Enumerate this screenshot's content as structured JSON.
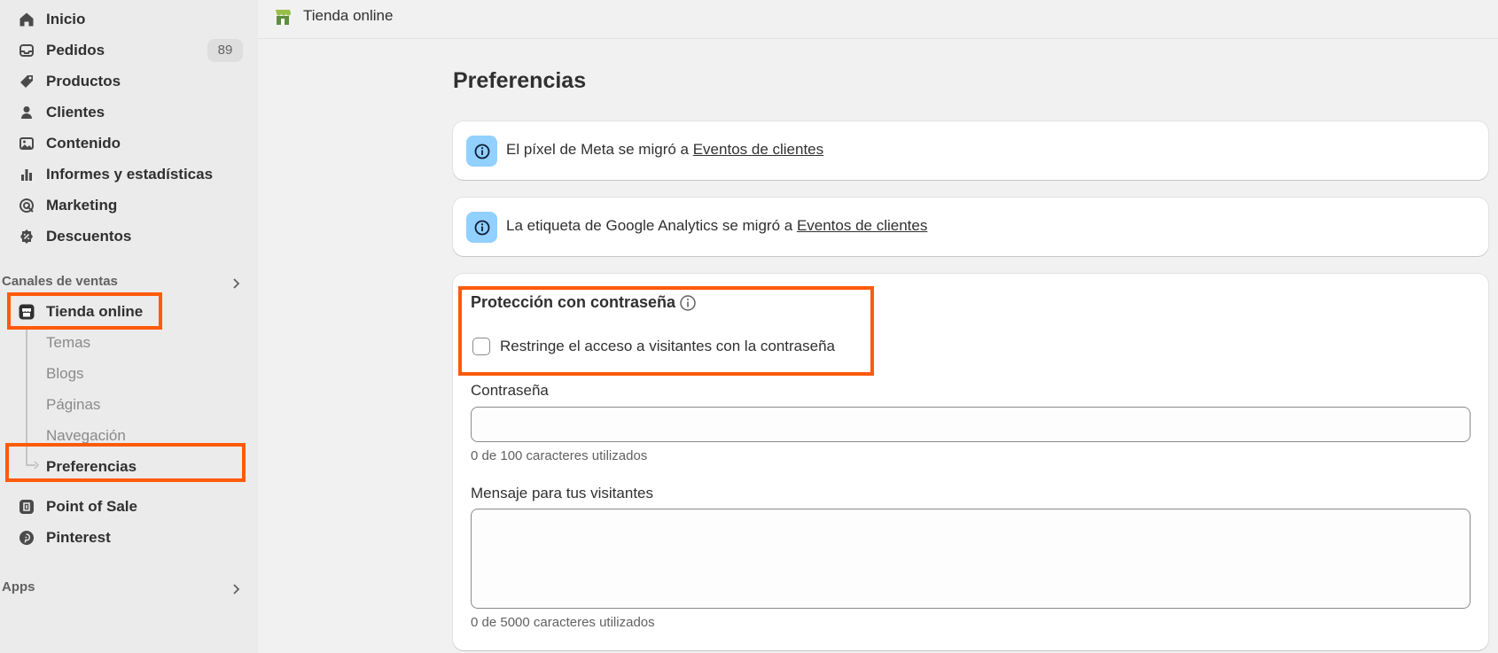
{
  "sidebar": {
    "nav": [
      {
        "label": "Inicio",
        "icon": "home-icon"
      },
      {
        "label": "Pedidos",
        "icon": "inbox-icon",
        "badge": "89"
      },
      {
        "label": "Productos",
        "icon": "tag-icon"
      },
      {
        "label": "Clientes",
        "icon": "person-icon"
      },
      {
        "label": "Contenido",
        "icon": "image-icon"
      },
      {
        "label": "Informes y estadísticas",
        "icon": "bar-chart-icon"
      },
      {
        "label": "Marketing",
        "icon": "target-icon"
      },
      {
        "label": "Descuentos",
        "icon": "discount-icon"
      }
    ],
    "sales_channels_heading": "Canales de ventas",
    "online_store": {
      "label": "Tienda online",
      "icon": "store-icon"
    },
    "online_store_sub": [
      {
        "label": "Temas"
      },
      {
        "label": "Blogs"
      },
      {
        "label": "Páginas"
      },
      {
        "label": "Navegación"
      },
      {
        "label": "Preferencias",
        "active": true
      }
    ],
    "point_of_sale": {
      "label": "Point of Sale",
      "icon": "pos-icon"
    },
    "pinterest": {
      "label": "Pinterest",
      "icon": "pinterest-icon"
    },
    "apps_heading": "Apps"
  },
  "topbar": {
    "title": "Tienda online",
    "icon": "shopify-store-icon"
  },
  "main": {
    "title": "Preferencias",
    "banners": [
      {
        "text": "El píxel de Meta se migró a ",
        "link": "Eventos de clientes"
      },
      {
        "text": "La etiqueta de Google Analytics se migró a ",
        "link": "Eventos de clientes"
      }
    ],
    "password_protection": {
      "title": "Protección con contraseña",
      "checkbox_label": "Restringe el acceso a visitantes con la contraseña",
      "checked": false,
      "password_label": "Contraseña",
      "password_value": "",
      "password_helper": "0 de 100 caracteres utilizados",
      "message_label": "Mensaje para tus visitantes",
      "message_value": "",
      "message_helper": "0 de 5000 caracteres utilizados"
    }
  },
  "colors": {
    "highlight": "#ff5a0a",
    "info_bg": "#91d0ff",
    "store_icon_green": "#95bf47"
  }
}
